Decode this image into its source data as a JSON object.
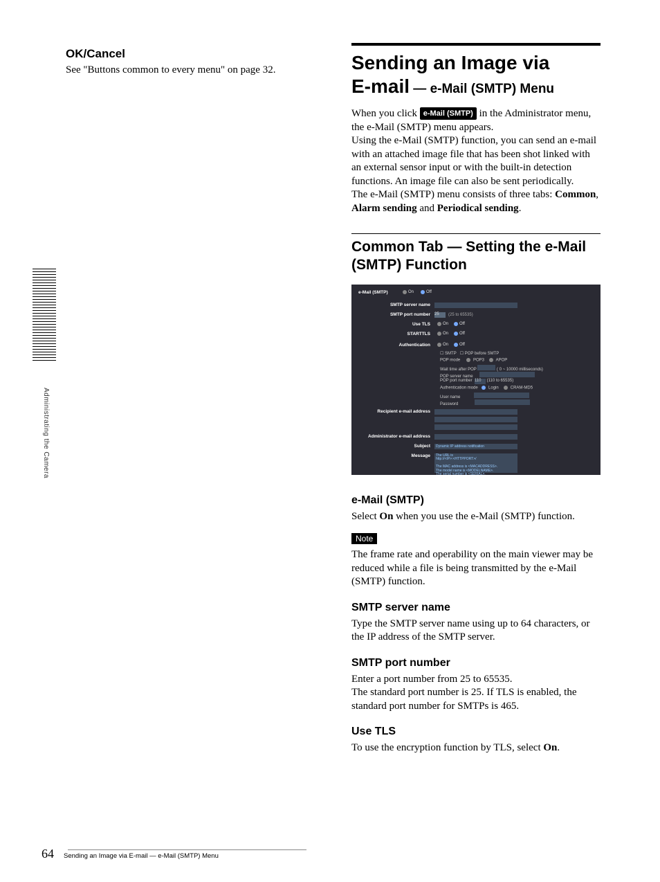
{
  "sidebar": {
    "label": "Administrating the Camera"
  },
  "left": {
    "heading": "OK/Cancel",
    "text": "See \"Buttons common to every menu\" on page 32."
  },
  "right": {
    "title_line1": "Sending an Image via",
    "title_line2_a": "E-mail",
    "title_line2_b": " — e-Mail (SMTP) Menu",
    "intro_a": "When you click ",
    "intro_button": "e-Mail (SMTP)",
    "intro_b": " in the Administrator menu, the e-Mail (SMTP) menu appears.",
    "intro_p2": "Using the e-Mail (SMTP) function, you can send an e-mail with an attached image file that has been shot linked with an external sensor input or with the built-in detection functions. An image file can also be sent periodically.",
    "intro_p3a": "The e-Mail (SMTP) menu consists of three tabs: ",
    "intro_p3_b1": "Common",
    "intro_p3_b2": "Alarm sending",
    "intro_p3_b3": "Periodical sending",
    "section_heading": "Common Tab — Setting the e-Mail (SMTP) Function",
    "screenshot": {
      "row_header": "e-Mail (SMTP)",
      "on": "On",
      "off": "Off",
      "smtp_server": "SMTP server name",
      "smtp_port": "SMTP port number",
      "smtp_port_val": "25",
      "smtp_port_hint": "(25 to 65535)",
      "use_tls": "Use TLS",
      "starttls": "STARTTLS",
      "auth": "Authentication",
      "smtp_cb": "SMTP",
      "pop_cb": "POP before SMTP",
      "pop_mode": "POP mode",
      "pop3": "POP3",
      "apop": "APOP",
      "wait": "Wait time after POP",
      "wait_hint": "( 0 ~ 10000 milliseconds)",
      "pop_server": "POP server name",
      "pop_port": "POP port number",
      "pop_port_val": "110",
      "pop_port_hint": "(110 to 65535)",
      "auth_mode": "Authentication mode",
      "login": "Login",
      "cram": "CRAM-MD5",
      "user": "User name",
      "pass": "Password",
      "recipient": "Recipient e-mail address",
      "admin": "Administrator e-mail address",
      "subject": "Subject",
      "subject_val": "Dynamic IP address notification",
      "message": "Message",
      "msg1": "The URL is",
      "msg2": "http://<IP>:<HTTPPORT>/",
      "msg3": "The MAC address is <MACADDRESS>.",
      "msg4": "The model name is <MODELNAME>.",
      "msg5": "The serial number is <SERIAL>."
    },
    "t1_h": "e-Mail (SMTP)",
    "t1_a": "Select ",
    "t1_b": "On",
    "t1_c": " when you use the e-Mail (SMTP) function.",
    "note_label": "Note",
    "note_text": "The frame rate and operability on the main viewer may be reduced while a file is being transmitted by the e-Mail (SMTP) function.",
    "t2_h": "SMTP server name",
    "t2_text": "Type the SMTP server name using up to 64 characters, or the IP address of the SMTP server.",
    "t3_h": "SMTP port number",
    "t3_text": "Enter a port number from 25 to 65535.\nThe standard port number is 25. If TLS is enabled, the standard port number for SMTPs is 465.",
    "t4_h": "Use TLS",
    "t4_a": "To use the encryption function by TLS, select ",
    "t4_b": "On",
    "t4_c": "."
  },
  "footer": {
    "page": "64",
    "title": "Sending an Image via E-mail — e-Mail (SMTP) Menu"
  }
}
